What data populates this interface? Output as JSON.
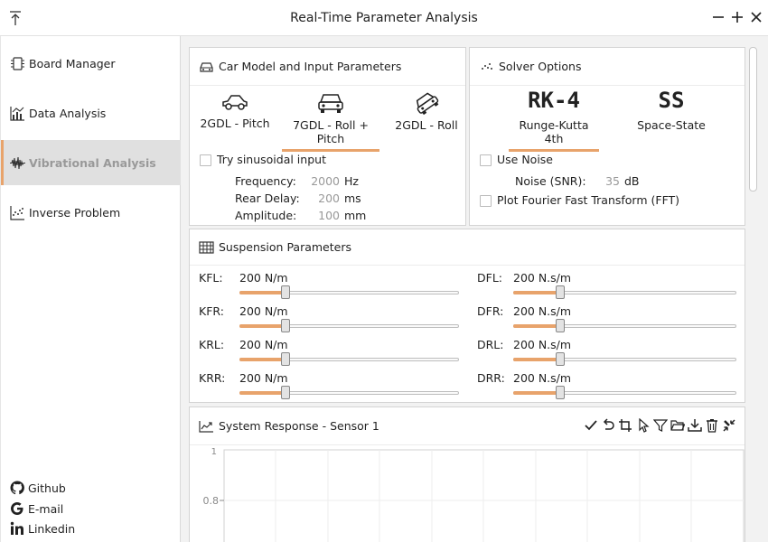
{
  "window": {
    "title": "Real-Time Parameter Analysis"
  },
  "sidebar": {
    "items": [
      {
        "label": "Board Manager",
        "icon": "chip-icon"
      },
      {
        "label": "Data Analysis",
        "icon": "chart-icon"
      },
      {
        "label": "Vibrational Analysis",
        "icon": "waveform-icon"
      },
      {
        "label": "Inverse Problem",
        "icon": "scatter-icon"
      }
    ],
    "active_index": 2,
    "links": [
      {
        "label": "Github",
        "icon": "github-icon"
      },
      {
        "label": "E-mail",
        "icon": "google-icon"
      },
      {
        "label": "Linkedin",
        "icon": "linkedin-icon"
      }
    ]
  },
  "car_model": {
    "title": "Car Model and Input Parameters",
    "models": [
      "2GDL - Pitch",
      "7GDL - Roll + Pitch",
      "2GDL - Roll"
    ],
    "selected_index": 1,
    "sinusoidal_label": "Try sinusoidal input",
    "sinusoidal_checked": false,
    "params": [
      {
        "label": "Frequency:",
        "value": "2000",
        "unit": "Hz"
      },
      {
        "label": "Rear Delay:",
        "value": "200",
        "unit": "ms"
      },
      {
        "label": "Amplitude:",
        "value": "100",
        "unit": "mm"
      }
    ]
  },
  "solver": {
    "title": "Solver Options",
    "methods": [
      {
        "short": "RK-4",
        "label": "Runge-Kutta 4th"
      },
      {
        "short": "SS",
        "label": "Space-State"
      }
    ],
    "selected_index": 0,
    "noise_label": "Use Noise",
    "noise_param_label": "Noise (SNR):",
    "noise_value": "35",
    "noise_unit": "dB",
    "fft_label": "Plot Fourier Fast Transform (FFT)"
  },
  "suspension": {
    "title": "Suspension Parameters",
    "left": [
      {
        "label": "KFL:",
        "value": "200 N/m",
        "fraction": 0.21
      },
      {
        "label": "KFR:",
        "value": "200 N/m",
        "fraction": 0.21
      },
      {
        "label": "KRL:",
        "value": "200 N/m",
        "fraction": 0.21
      },
      {
        "label": "KRR:",
        "value": "200 N/m",
        "fraction": 0.21
      }
    ],
    "right": [
      {
        "label": "DFL:",
        "value": "200 N.s/m",
        "fraction": 0.21
      },
      {
        "label": "DFR:",
        "value": "200 N.s/m",
        "fraction": 0.21
      },
      {
        "label": "DRL:",
        "value": "200 N.s/m",
        "fraction": 0.21
      },
      {
        "label": "DRR:",
        "value": "200 N.s/m",
        "fraction": 0.21
      }
    ]
  },
  "response": {
    "title": "System Response - Sensor 1",
    "y_ticks": [
      "1",
      "0.8"
    ],
    "toolbar": [
      "check-icon",
      "undo-icon",
      "crop-icon",
      "pointer-icon",
      "filter-icon",
      "folder-icon",
      "download-icon",
      "trash-icon",
      "collapse-icon"
    ]
  },
  "colors": {
    "accent": "#e8a36b"
  }
}
